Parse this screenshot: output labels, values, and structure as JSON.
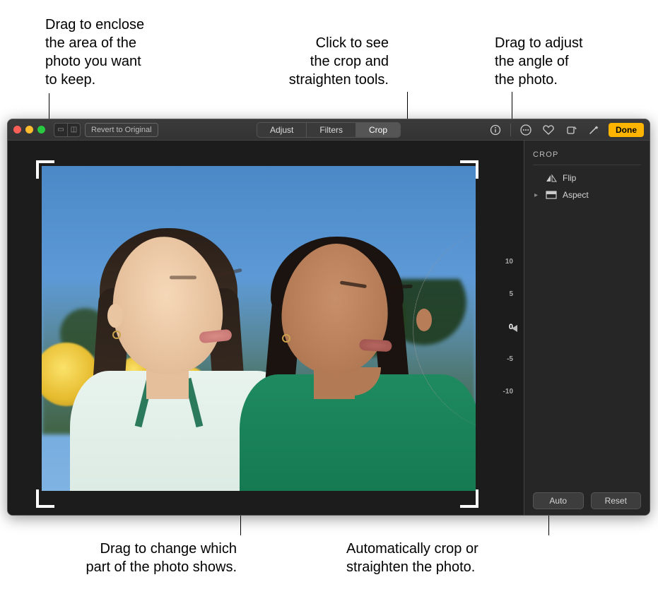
{
  "callouts": {
    "crop_box": "Drag to enclose\nthe area of the\nphoto you want\nto keep.",
    "crop_tab": "Click to see\nthe crop and\nstraighten tools.",
    "angle": "Drag to adjust\nthe angle of\nthe photo.",
    "pan": "Drag to change which\npart of the photo shows.",
    "auto": "Automatically crop or\nstraighten the photo."
  },
  "toolbar": {
    "revert_label": "Revert to Original",
    "tabs": {
      "adjust": "Adjust",
      "filters": "Filters",
      "crop": "Crop"
    },
    "done_label": "Done"
  },
  "sidebar": {
    "title": "CROP",
    "flip_label": "Flip",
    "aspect_label": "Aspect",
    "auto_label": "Auto",
    "reset_label": "Reset"
  },
  "dial": {
    "ticks": [
      "10",
      "5",
      "0",
      "-5",
      "-10"
    ],
    "current_value": "0"
  }
}
